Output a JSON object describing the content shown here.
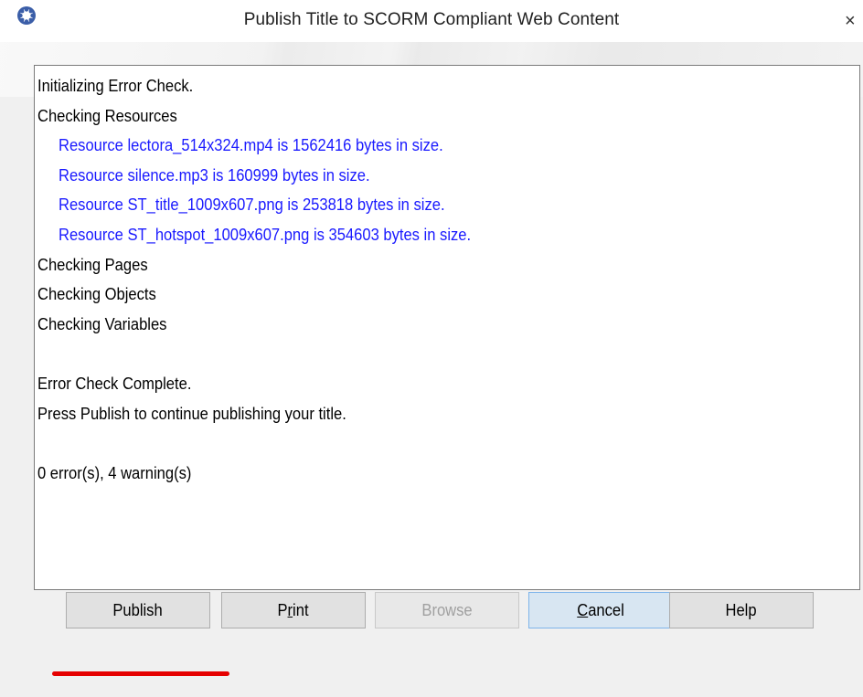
{
  "window": {
    "title": "Publish Title to SCORM Compliant Web Content",
    "close_glyph": "×"
  },
  "log": {
    "lines": [
      {
        "text": "Initializing Error Check.",
        "style": "normal"
      },
      {
        "text": "Checking Resources",
        "style": "normal"
      },
      {
        "text": "Resource lectora_514x324.mp4 is 1562416 bytes in size.",
        "style": "warning"
      },
      {
        "text": "Resource silence.mp3 is 160999 bytes in size.",
        "style": "warning"
      },
      {
        "text": "Resource ST_title_1009x607.png is 253818 bytes in size.",
        "style": "warning"
      },
      {
        "text": "Resource ST_hotspot_1009x607.png is 354603 bytes in size.",
        "style": "warning"
      },
      {
        "text": "Checking Pages",
        "style": "normal"
      },
      {
        "text": "Checking Objects",
        "style": "normal"
      },
      {
        "text": "Checking Variables",
        "style": "normal"
      },
      {
        "text": "",
        "style": "normal"
      },
      {
        "text": "Error Check Complete.",
        "style": "normal"
      },
      {
        "text": "Press Publish to continue publishing your title.",
        "style": "normal"
      },
      {
        "text": "",
        "style": "normal"
      },
      {
        "text": "0 error(s), 4 warning(s)",
        "style": "normal"
      }
    ]
  },
  "buttons": {
    "publish": "Publish",
    "print_pre": "P",
    "print_ul": "r",
    "print_post": "int",
    "browse": "Browse",
    "cancel_ul": "C",
    "cancel_post": "ancel",
    "help": "Help"
  },
  "colors": {
    "warning_text": "#1a1aff",
    "annotation_underline": "#e50000"
  },
  "icons": {
    "app": "gear-icon",
    "close": "close-icon"
  }
}
